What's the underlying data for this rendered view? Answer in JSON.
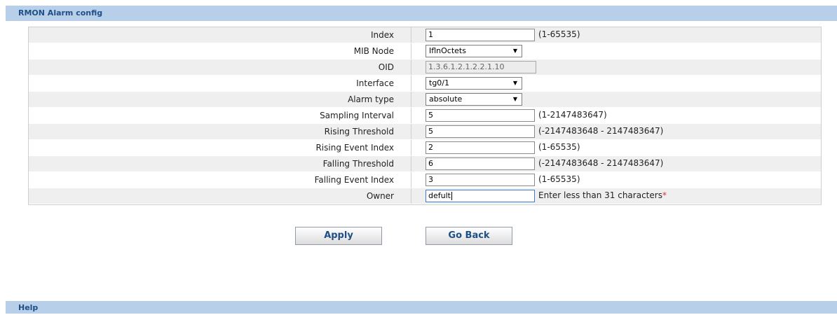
{
  "header": {
    "title": "RMON Alarm config"
  },
  "help": {
    "title": "Help"
  },
  "form": {
    "index": {
      "label": "Index",
      "value": "1",
      "hint": "(1-65535)"
    },
    "mib_node": {
      "label": "MIB Node",
      "selected": "IflnOctets"
    },
    "oid": {
      "label": "OID",
      "value": "1.3.6.1.2.1.2.2.1.10"
    },
    "interface": {
      "label": "Interface",
      "selected": "tg0/1"
    },
    "alarm_type": {
      "label": "Alarm type",
      "selected": "absolute"
    },
    "sampling_interval": {
      "label": "Sampling Interval",
      "value": "5",
      "hint": "(1-2147483647)"
    },
    "rising_threshold": {
      "label": "Rising Threshold",
      "value": "5",
      "hint": "(-2147483648 - 2147483647)"
    },
    "rising_event_index": {
      "label": "Rising Event Index",
      "value": "2",
      "hint": "(1-65535)"
    },
    "falling_threshold": {
      "label": "Falling Threshold",
      "value": "6",
      "hint": "(-2147483648 - 2147483647)"
    },
    "falling_event_index": {
      "label": "Falling Event Index",
      "value": "3",
      "hint": "(1-65535)"
    },
    "owner": {
      "label": "Owner",
      "value": "defult",
      "hint": "Enter less than 31 characters",
      "required_mark": "*"
    }
  },
  "buttons": {
    "apply": "Apply",
    "back": "Go Back"
  },
  "icons": {
    "dropdown": "chevron-down-icon"
  },
  "colors": {
    "header_bg": "#b7cfe9",
    "header_text": "#1f4f86",
    "row_shade": "#efefef",
    "required": "#e03030"
  }
}
